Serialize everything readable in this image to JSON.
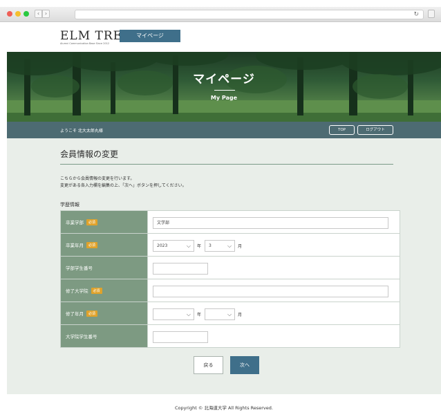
{
  "header": {
    "logo": "ELM TREE",
    "logo_sub": "Alumni Communication Base Since 2012",
    "tab": "マイページ"
  },
  "hero": {
    "title": "マイページ",
    "subtitle": "My Page"
  },
  "user_bar": {
    "welcome": "ようこそ 北大太郎丸様",
    "top_button": "TOP",
    "logout_button": "ログアウト"
  },
  "main": {
    "page_title": "会員情報の変更",
    "intro_line1": "こちらから会員情報の変更を行います。",
    "intro_line2": "変更がある各入力欄を編集の上、「次へ」ボタンを押してください。",
    "section_label": "学歴情報",
    "required_badge": "必須",
    "rows": [
      {
        "label": "卒業学部",
        "value": "文学部"
      },
      {
        "label": "卒業年月",
        "year": "2023",
        "year_unit": "年",
        "month": "3",
        "month_unit": "月"
      },
      {
        "label": "学部学生番号",
        "value": ""
      },
      {
        "label": "修了大学院",
        "value": ""
      },
      {
        "label": "修了年月",
        "year": "",
        "year_unit": "年",
        "month": "",
        "month_unit": "月"
      },
      {
        "label": "大学院学生番号",
        "value": ""
      }
    ],
    "back_button": "戻る",
    "next_button": "次へ"
  },
  "footer": {
    "copyright": "Copyright © 北海道大学 All Rights Reserved."
  },
  "colors": {
    "accent": "#3f6f8a",
    "user_bar": "#4d6b72",
    "table_header": "#7d9a82",
    "required_badge": "#e0a22a",
    "page_background": "#e9eee9"
  },
  "icons": [
    "chevron-left-icon",
    "chevron-right-icon",
    "reload-icon",
    "chevron-down-icon"
  ]
}
